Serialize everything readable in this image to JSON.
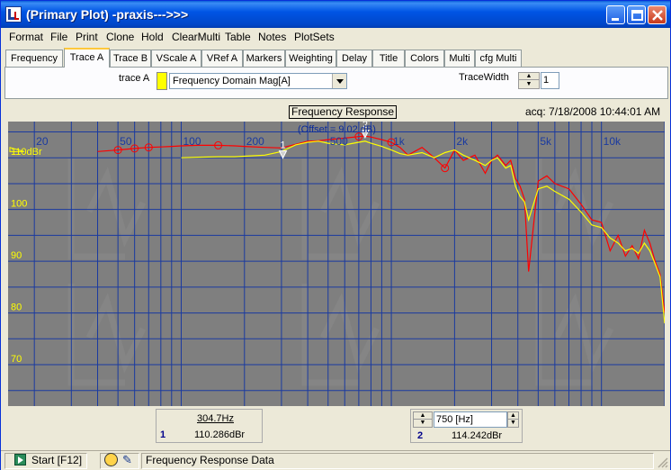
{
  "window": {
    "title": "(Primary Plot) -praxis--->>>",
    "buttons": {
      "minimize": "minimize",
      "maximize": "maximize",
      "close": "close"
    }
  },
  "menu": [
    "Format",
    "File",
    "Print",
    "Clone",
    "Hold",
    "ClearMulti",
    "Table",
    "Notes",
    "PlotSets"
  ],
  "tabs": [
    "Frequency",
    "Trace A",
    "Trace B",
    "VScale A",
    "VRef A",
    "Markers",
    "Weighting",
    "Delay",
    "Title",
    "Colors",
    "Multi",
    "cfg Multi"
  ],
  "active_tab": "Trace A",
  "trace_panel": {
    "trace_label": "trace A",
    "trace_color": "#ffff00",
    "trace_value": "Frequency Domain Mag[A]",
    "tracewidth_label": "TraceWidth",
    "tracewidth_value": "1"
  },
  "plot": {
    "title": "Frequency Response",
    "offset_note": "(Offset = 9.02 dB)",
    "acq": "acq: 7/18/2008 10:44:01 AM",
    "background": "#7f7f7f",
    "grid_color": "#1a3aa0",
    "x_tick_labels": [
      "20",
      "50",
      "100",
      "200",
      "500",
      "1k",
      "2k",
      "5k",
      "10k"
    ],
    "y_tick_labels": [
      "110dBr",
      "100",
      "90",
      "80",
      "70"
    ],
    "marker_labels": [
      "1",
      "2"
    ]
  },
  "chart_data": {
    "type": "line",
    "title": "Frequency Response",
    "xlabel": "",
    "ylabel": "",
    "x_scale": "log",
    "xlim": [
      15,
      20000
    ],
    "ylim": [
      62,
      117
    ],
    "grid": true,
    "series": [
      {
        "color": "#ff0000",
        "x": [
          40,
          50,
          60,
          70,
          80,
          90,
          100,
          120,
          150,
          180,
          200,
          250,
          300,
          350,
          400,
          450,
          500,
          600,
          700,
          750,
          800,
          900,
          1000,
          1100,
          1200,
          1400,
          1600,
          1800,
          2000,
          2200,
          2500,
          2800,
          3000,
          3200,
          3500,
          3700,
          3900,
          4100,
          4300,
          4500,
          5000,
          5500,
          6000,
          7000,
          8000,
          9000,
          10000,
          11000,
          12000,
          13000,
          14000,
          15000,
          16000,
          17000,
          18000,
          19000,
          20000
        ],
        "y": [
          111.2,
          111.5,
          111.8,
          112.0,
          112.1,
          112.2,
          112.3,
          112.4,
          112.4,
          112.3,
          112.2,
          112.0,
          111.9,
          112.6,
          113.2,
          113.3,
          113.5,
          113.8,
          114.1,
          114.2,
          114.0,
          113.5,
          113.0,
          112.0,
          110.5,
          112.0,
          110.0,
          108.0,
          111.5,
          109.5,
          110.5,
          107.0,
          109.5,
          110.5,
          108.5,
          109.5,
          106.0,
          104.5,
          102.0,
          88.0,
          105.5,
          106.5,
          105.0,
          104.0,
          101.0,
          98.0,
          97.5,
          92.0,
          95.0,
          91.0,
          93.0,
          90.5,
          96.0,
          93.5,
          90.0,
          87.5,
          80.0
        ]
      },
      {
        "color": "#ffff00",
        "x": [
          100,
          120,
          150,
          180,
          200,
          250,
          300,
          350,
          400,
          450,
          500,
          600,
          700,
          750,
          800,
          900,
          1000,
          1100,
          1200,
          1400,
          1600,
          1800,
          2000,
          2200,
          2500,
          2800,
          3000,
          3200,
          3500,
          3700,
          3900,
          4100,
          4300,
          4500,
          5000,
          5500,
          6000,
          7000,
          8000,
          9000,
          10000,
          11000,
          12000,
          13000,
          14000,
          15000,
          16000,
          17000,
          18000,
          19000,
          20000
        ],
        "y": [
          110.0,
          110.1,
          110.2,
          110.2,
          110.3,
          110.5,
          111.2,
          112.5,
          113.0,
          113.2,
          112.8,
          112.5,
          113.0,
          113.2,
          112.8,
          112.2,
          111.5,
          110.8,
          110.5,
          111.0,
          110.0,
          111.0,
          111.5,
          110.5,
          109.5,
          108.5,
          109.5,
          110.0,
          108.0,
          108.5,
          104.5,
          102.5,
          101.5,
          98.0,
          104.0,
          104.5,
          103.5,
          102.0,
          99.5,
          97.0,
          96.5,
          94.5,
          93.5,
          92.0,
          92.5,
          91.5,
          93.5,
          92.0,
          89.5,
          87.0,
          78.0
        ]
      }
    ],
    "markers": [
      {
        "label": "1",
        "x": 304.7,
        "y": 110.286
      },
      {
        "label": "2",
        "x": 750,
        "y": 114.242
      }
    ]
  },
  "cursor1": {
    "freq": "304.7Hz",
    "num": "1",
    "value": "110.286dBr"
  },
  "cursor2": {
    "field": "750 [Hz]",
    "num": "2",
    "value": "114.242dBr"
  },
  "status": {
    "start": "Start [F12]",
    "text": "Frequency Response Data"
  }
}
